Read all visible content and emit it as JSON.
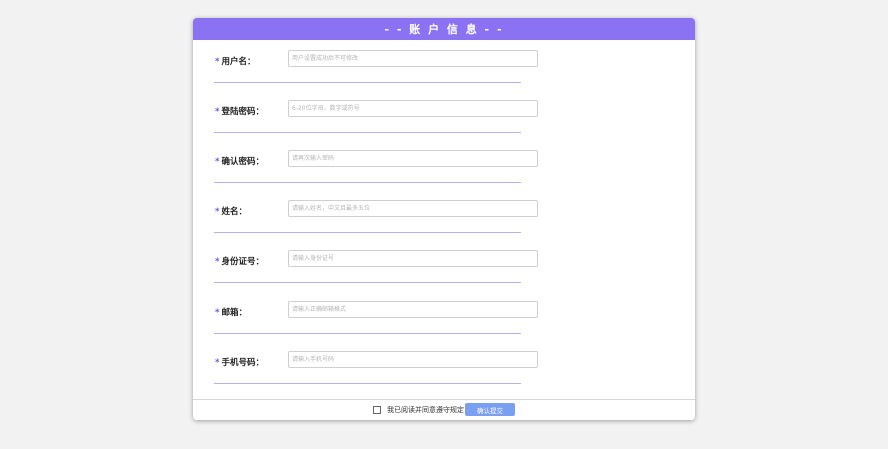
{
  "header": {
    "title": "- - 账 户 信 息 - -"
  },
  "form": {
    "star": "*",
    "fields": [
      {
        "label": "用户名：",
        "placeholder": "用户设置成功后不可修改"
      },
      {
        "label": "登陆密码：",
        "placeholder": "6-20位字母，数字或符号"
      },
      {
        "label": "确认密码：",
        "placeholder": "请再次输入密码"
      },
      {
        "label": "姓名：",
        "placeholder": "请输入姓名，中文且最多五位"
      },
      {
        "label": "身份证号：",
        "placeholder": "请输入身份证号"
      },
      {
        "label": "邮箱：",
        "placeholder": "请输入正确邮箱格式"
      },
      {
        "label": "手机号码：",
        "placeholder": "请输入手机号码"
      }
    ]
  },
  "footer": {
    "agree_label": "我已阅读并同意遵守规定",
    "submit_label": "确认提交"
  },
  "colors": {
    "header_bg": "#8a72f2",
    "required_star": "#6f53e8",
    "divider": "#b8b0ea",
    "submit_bg": "#7b9ff0",
    "page_bg": "#f2f2f2"
  }
}
